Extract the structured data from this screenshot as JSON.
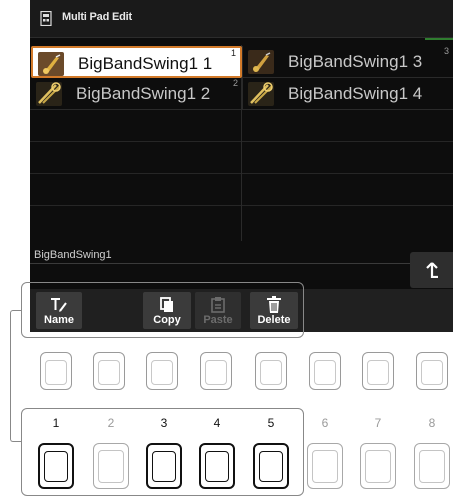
{
  "screen": {
    "title": "Multi Pad Edit",
    "title_icon": "multipad-icon",
    "cells": [
      {
        "label": "BigBandSwing1 1",
        "number": "1",
        "selected": true,
        "icon": "saxophone-icon"
      },
      {
        "label": "BigBandSwing1 3",
        "number": "3",
        "selected": false,
        "icon": "saxophone-icon"
      },
      {
        "label": "BigBandSwing1 2",
        "number": "2",
        "selected": false,
        "icon": "trombone-icon"
      },
      {
        "label": "BigBandSwing1 4",
        "number": "",
        "selected": false,
        "icon": "trombone-icon"
      }
    ],
    "info_label": "BigBandSwing1",
    "exit_icon": "up-arrow-icon",
    "buttons": {
      "name": {
        "label": "Name",
        "icon": "text-edit-icon",
        "enabled": true
      },
      "copy": {
        "label": "Copy",
        "icon": "copy-icon",
        "enabled": true
      },
      "paste": {
        "label": "Paste",
        "icon": "paste-icon",
        "enabled": false
      },
      "delete": {
        "label": "Delete",
        "icon": "trash-icon",
        "enabled": true
      }
    }
  },
  "hardware": {
    "numbers": [
      "1",
      "2",
      "3",
      "4",
      "5",
      "6",
      "7",
      "8"
    ],
    "active": [
      true,
      false,
      true,
      true,
      true,
      false,
      false,
      false
    ]
  },
  "colors": {
    "selection_border": "#d27a2a",
    "screen_bg": "#0d0d0d",
    "accent_line": "#2f7d2f"
  }
}
